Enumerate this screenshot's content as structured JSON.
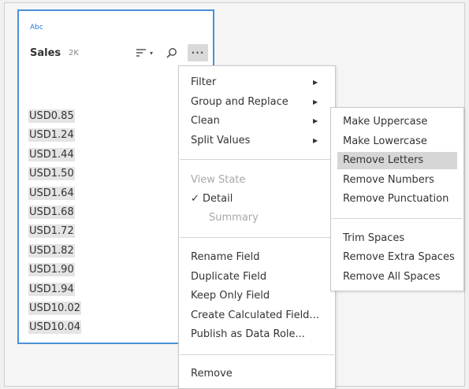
{
  "profile_card": {
    "type_label": "Abc",
    "field_name": "Sales",
    "field_count": "2K",
    "values": [
      "USD0.85",
      "USD1.24",
      "USD1.44",
      "USD1.50",
      "USD1.64",
      "USD1.68",
      "USD1.72",
      "USD1.82",
      "USD1.90",
      "USD1.94",
      "USD10.02",
      "USD10.04"
    ],
    "icons": {
      "sort": "sort-icon",
      "sort_caret": "chevron-down-icon",
      "search": "search-icon",
      "more": "more-options-icon"
    }
  },
  "context_menu": {
    "filter": "Filter",
    "group_replace": "Group and Replace",
    "clean": "Clean",
    "split_values": "Split Values",
    "view_state": "View State",
    "detail": "Detail",
    "detail_check": "✓",
    "summary": "Summary",
    "rename_field": "Rename Field",
    "duplicate_field": "Duplicate Field",
    "keep_only_field": "Keep Only Field",
    "create_calculated_field": "Create Calculated Field...",
    "publish_data_role": "Publish as Data Role...",
    "remove": "Remove"
  },
  "clean_submenu": {
    "make_uppercase": "Make Uppercase",
    "make_lowercase": "Make Lowercase",
    "remove_letters": "Remove Letters",
    "remove_numbers": "Remove Numbers",
    "remove_punctuation": "Remove Punctuation",
    "trim_spaces": "Trim Spaces",
    "remove_extra_spaces": "Remove Extra Spaces",
    "remove_all_spaces": "Remove All Spaces",
    "active_item": "Remove Letters"
  },
  "colors": {
    "accent": "#4a90d9",
    "highlight": "#d6d6d6"
  }
}
